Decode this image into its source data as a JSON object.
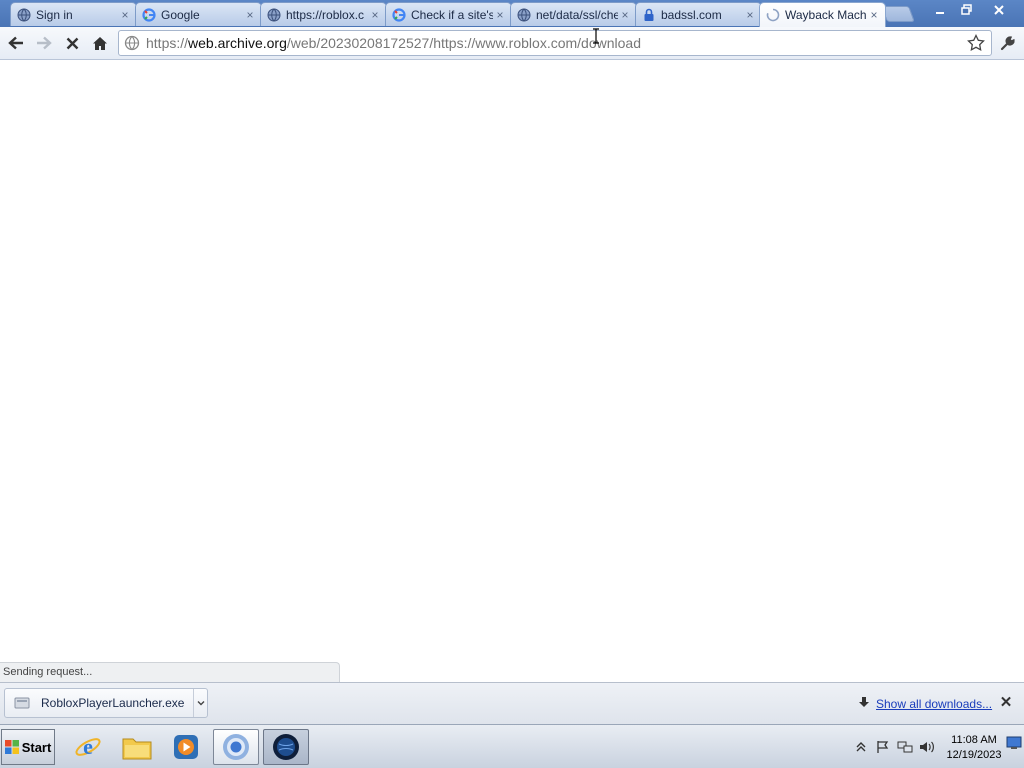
{
  "browser": {
    "tabs": [
      {
        "title": "Sign in",
        "icon": "globe-icon",
        "active": false
      },
      {
        "title": "Google",
        "icon": "google-icon",
        "active": false
      },
      {
        "title": "https://roblox.c",
        "icon": "globe-icon",
        "active": false
      },
      {
        "title": "Check if a site's",
        "icon": "google-icon",
        "active": false
      },
      {
        "title": "net/data/ssl/che",
        "icon": "globe-icon",
        "active": false
      },
      {
        "title": "badssl.com",
        "icon": "lock-icon",
        "active": false
      },
      {
        "title": "Wayback Machi",
        "icon": "loading-spinner-icon",
        "active": true
      }
    ],
    "tab_close_glyph": "×",
    "address": {
      "scheme": "https://",
      "domain": "web.archive.org",
      "path": "/web/20230208172527/https://www.roblox.com/download"
    },
    "status_text": "Sending request..."
  },
  "downloads": {
    "file_name": "RobloxPlayerLauncher.exe",
    "show_all_label": "Show all downloads..."
  },
  "taskbar": {
    "start_label": "Start",
    "time": "11:08 AM",
    "date": "12/19/2023",
    "pinned": [
      "internet-explorer-icon",
      "windows-explorer-icon",
      "media-player-icon",
      "chrome-icon",
      "app-globe-icon"
    ]
  },
  "colors": {
    "titlebar": "#4a74b5",
    "active_tab": "#ffffff",
    "link": "#1a3dbb"
  }
}
